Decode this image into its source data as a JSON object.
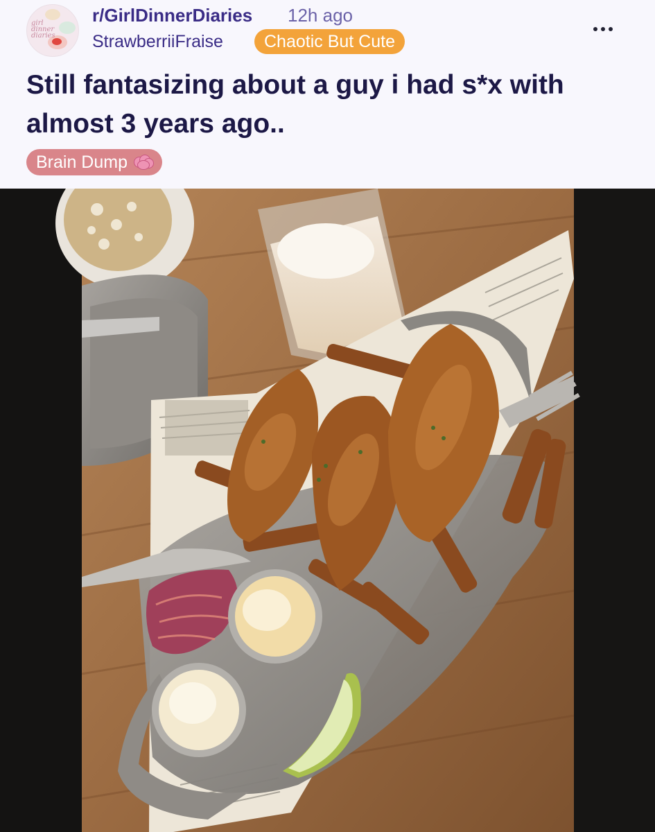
{
  "header": {
    "subreddit": "r/GirlDinnerDiaries",
    "time_ago": "12h ago",
    "username": "StrawberriiFraise",
    "user_flair": "Chaotic But Cute",
    "avatar_icon": "subreddit-avatar-icon",
    "more_icon": "more-options-icon"
  },
  "post": {
    "title": "Still fantasizing about a guy i had s*x with almost 3 years ago..",
    "flair_label": "Brain Dump",
    "flair_icon": "brain-icon"
  },
  "colors": {
    "header_bg": "#f8f7fd",
    "subreddit_text": "#3a2c86",
    "user_flair_bg": "#f3a33a",
    "post_flair_bg": "#d9858a",
    "title_text": "#1c1846"
  },
  "media": {
    "type": "photo"
  }
}
